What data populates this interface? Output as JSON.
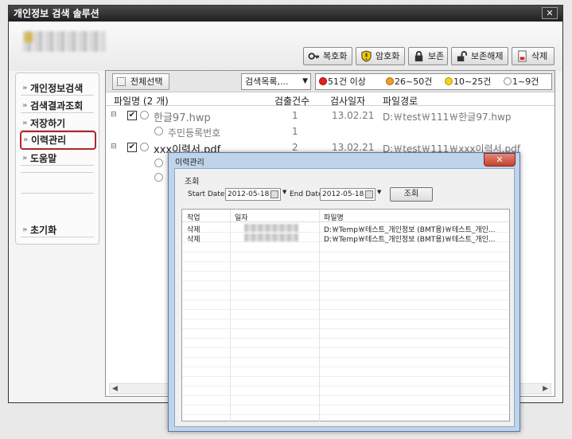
{
  "window": {
    "title": "개인정보 검색 솔루션",
    "close_label": "✕"
  },
  "toolbar": {
    "buttons": [
      {
        "label": "복호화",
        "icon": "key-icon"
      },
      {
        "label": "암호화",
        "icon": "shield-icon"
      },
      {
        "label": "보존",
        "icon": "lock-icon"
      },
      {
        "label": "보존해제",
        "icon": "unlock-icon"
      },
      {
        "label": "삭제",
        "icon": "delete-doc-icon"
      }
    ]
  },
  "sidebar": {
    "items": [
      {
        "label": "개인정보검색"
      },
      {
        "label": "검색결과조회"
      },
      {
        "label": "저장하기"
      },
      {
        "label": "이력관리"
      },
      {
        "label": "도움말"
      },
      {
        "label": "초기화"
      }
    ],
    "active_index": 3
  },
  "content": {
    "select_all": "전체선택",
    "dropdown_value": "검색목록,...",
    "legend": [
      {
        "label": "51건 이상",
        "color": "#e0241b"
      },
      {
        "label": "26~50건",
        "color": "#f29c1f"
      },
      {
        "label": "10~25건",
        "color": "#f2d21f"
      },
      {
        "label": "1~9건",
        "color": "#ffffff"
      }
    ],
    "columns": [
      "파일명 (2 개)",
      "검출건수",
      "검사일자",
      "파일경로"
    ],
    "rows": [
      {
        "name": "한글97.hwp",
        "count": "1",
        "date": "13.02.21",
        "path": "D:￦test￦111￦한글97.hwp"
      },
      {
        "name": "주민등록번호",
        "count": "1",
        "date": "",
        "path": ""
      },
      {
        "name": "xxx이력서.pdf",
        "count": "2",
        "date": "13.02.21",
        "path": "D:￦test￦111￦xxx이력서.pdf"
      }
    ]
  },
  "dialog": {
    "title": "이력관리",
    "group_label": "조회",
    "start_label": "Start Date",
    "start_value": "2012-05-18",
    "end_label": "End Date",
    "end_value": "2012-05-18",
    "query_button": "조회",
    "columns": [
      "작업",
      "일자",
      "파일명"
    ],
    "rows": [
      {
        "action": "삭제",
        "file": "D:￦Temp￦테스트_개인정보 (BMT용)￦테스트_개인..."
      },
      {
        "action": "삭제",
        "file": "D:￦Temp￦테스트_개인정보 (BMT용)￦테스트_개인..."
      }
    ]
  }
}
